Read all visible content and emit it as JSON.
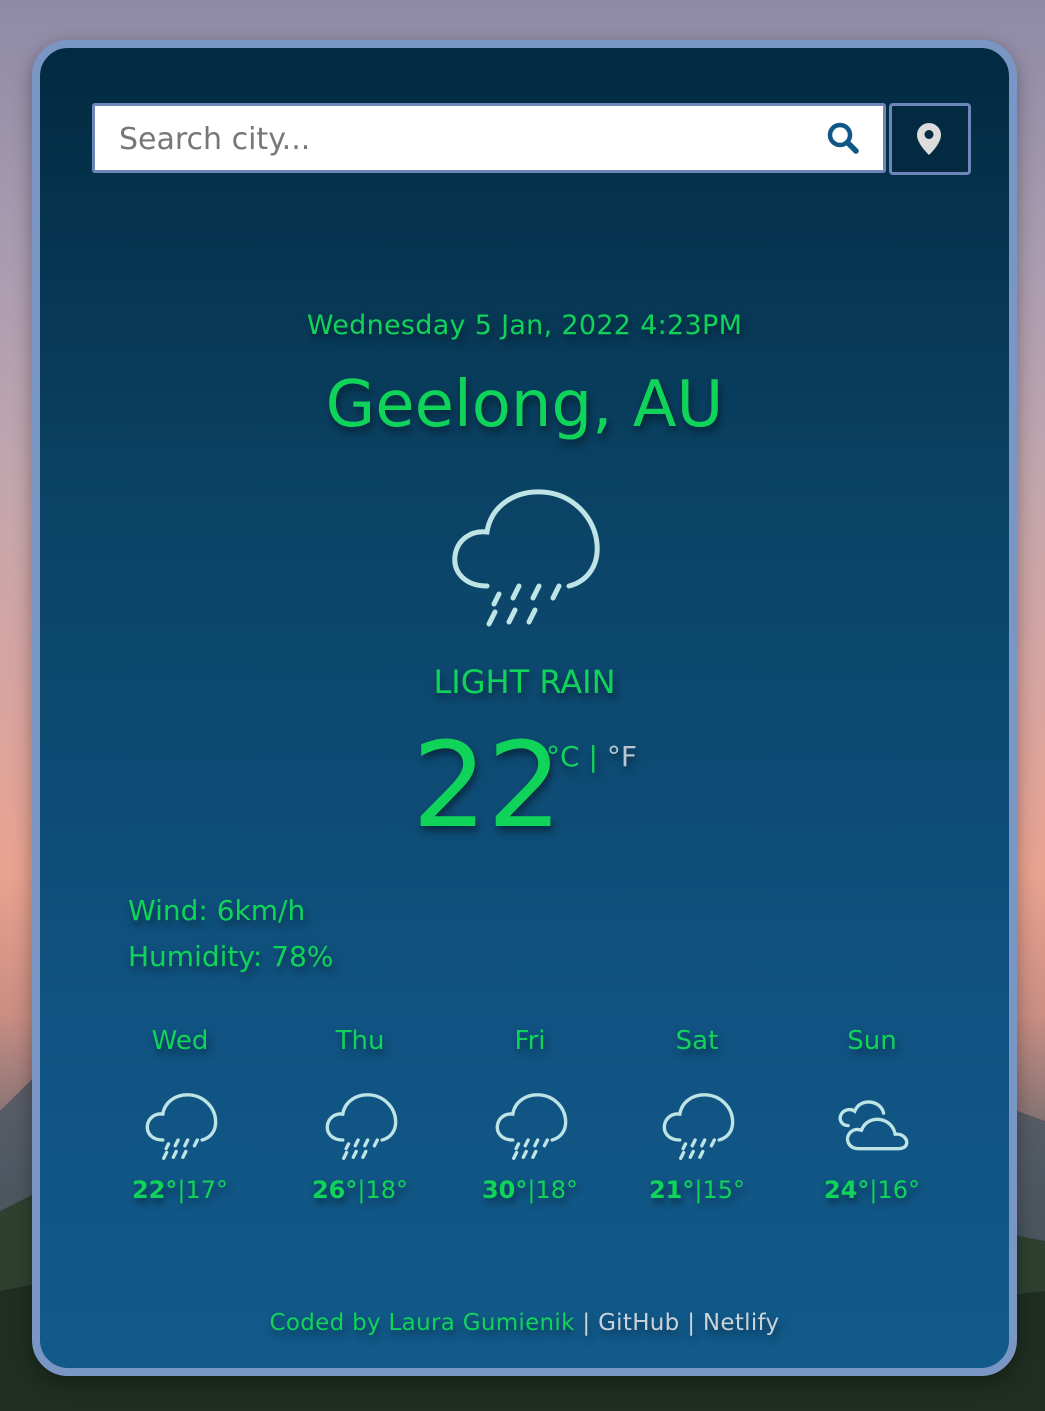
{
  "search": {
    "placeholder": "Search city..."
  },
  "icons": {
    "search": "search-icon",
    "location": "location-pin-icon",
    "rain": "rain-cloud-icon",
    "cloudy": "cloudy-icon"
  },
  "colors": {
    "accent_green": "#10d45a",
    "card_border": "#7a96c4",
    "card_bg_top": "#022a40",
    "card_bg_bottom": "#115a8a",
    "icon_stroke": "#bfe4e6"
  },
  "current": {
    "datetime": "Wednesday 5 Jan, 2022 4:23PM",
    "city": "Geelong, AU",
    "description": "LIGHT RAIN",
    "temperature": "22",
    "unit_c": "°C",
    "unit_separator": "|",
    "unit_f": "°F",
    "wind": "Wind: 6km/h",
    "humidity": "Humidity: 78%"
  },
  "forecast": [
    {
      "day": "Wed",
      "max": "22°",
      "sep": "|",
      "min": "17°",
      "icon": "rain-cloud-icon"
    },
    {
      "day": "Thu",
      "max": "26°",
      "sep": "|",
      "min": "18°",
      "icon": "rain-cloud-icon"
    },
    {
      "day": "Fri",
      "max": "30°",
      "sep": "|",
      "min": "18°",
      "icon": "rain-cloud-icon"
    },
    {
      "day": "Sat",
      "max": "21°",
      "sep": "|",
      "min": "15°",
      "icon": "rain-cloud-icon"
    },
    {
      "day": "Sun",
      "max": "24°",
      "sep": "|",
      "min": "16°",
      "icon": "cloudy-icon"
    }
  ],
  "footer": {
    "credit": "Coded by Laura Gumienik",
    "separator1": "|",
    "github": "GitHub",
    "separator2": "|",
    "netlify": "Netlify"
  }
}
